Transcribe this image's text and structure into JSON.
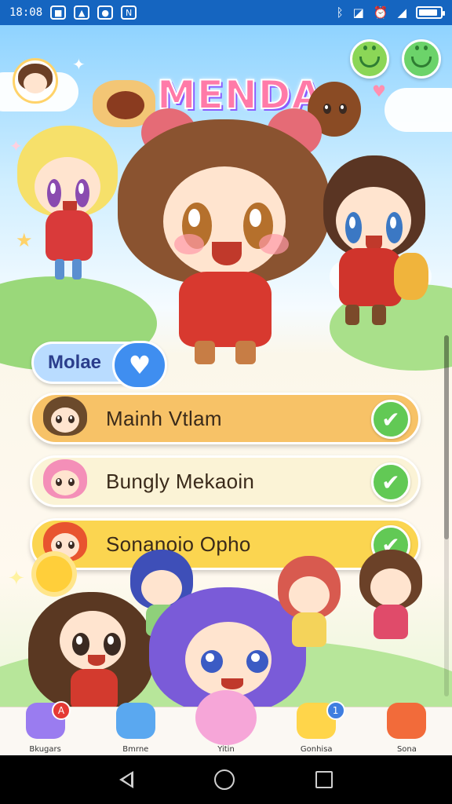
{
  "status_bar": {
    "time": "18:08",
    "notif_icons": [
      "square-icon",
      "photo-icon",
      "chat-icon",
      "n-icon"
    ],
    "right_icons": [
      "bluetooth-icon",
      "signal-off-icon",
      "alarm-icon",
      "cell-signal-icon"
    ],
    "battery_level": 0.9
  },
  "header": {
    "logo_text": "MENDA"
  },
  "selector": {
    "label": "Molae",
    "heart": "♥"
  },
  "list": {
    "items": [
      {
        "name": "Mainh Vtlam",
        "check": "✔",
        "color": "#f7c267",
        "thumb_hair": "#6b4a2b"
      },
      {
        "name": "Bungly Mekaoin",
        "check": "✔",
        "color": "#fbf3d6",
        "thumb_hair": "#f48fb8"
      },
      {
        "name": "Sonanoio Opho",
        "check": "✔",
        "color": "#fbd550",
        "thumb_hair": "#e8542f"
      }
    ]
  },
  "tabs": [
    {
      "label": "Bkugars",
      "badge": "A",
      "badge_color": "#e53935",
      "icon_color": "#9a7cf0",
      "icon": "monster-icon"
    },
    {
      "label": "Bmrne",
      "badge": "",
      "badge_color": "",
      "icon_color": "#5aa8f0",
      "icon": "checklist-icon"
    },
    {
      "label": "Yitin",
      "badge": "",
      "badge_color": "",
      "icon_color": "#f6a6d8",
      "icon": "pink-character-icon",
      "active": true
    },
    {
      "label": "Gonhisa",
      "badge": "1",
      "badge_color": "#3f7ee0",
      "icon_color": "#ffd54a",
      "icon": "chick-icon"
    },
    {
      "label": "Sona",
      "badge": "",
      "badge_color": "",
      "icon_color": "#f26b3a",
      "icon": "fox-icon"
    }
  ],
  "colors": {
    "status_bar": "#1565c0",
    "check_green": "#62c955",
    "selector_blue": "#3f8ef0"
  }
}
